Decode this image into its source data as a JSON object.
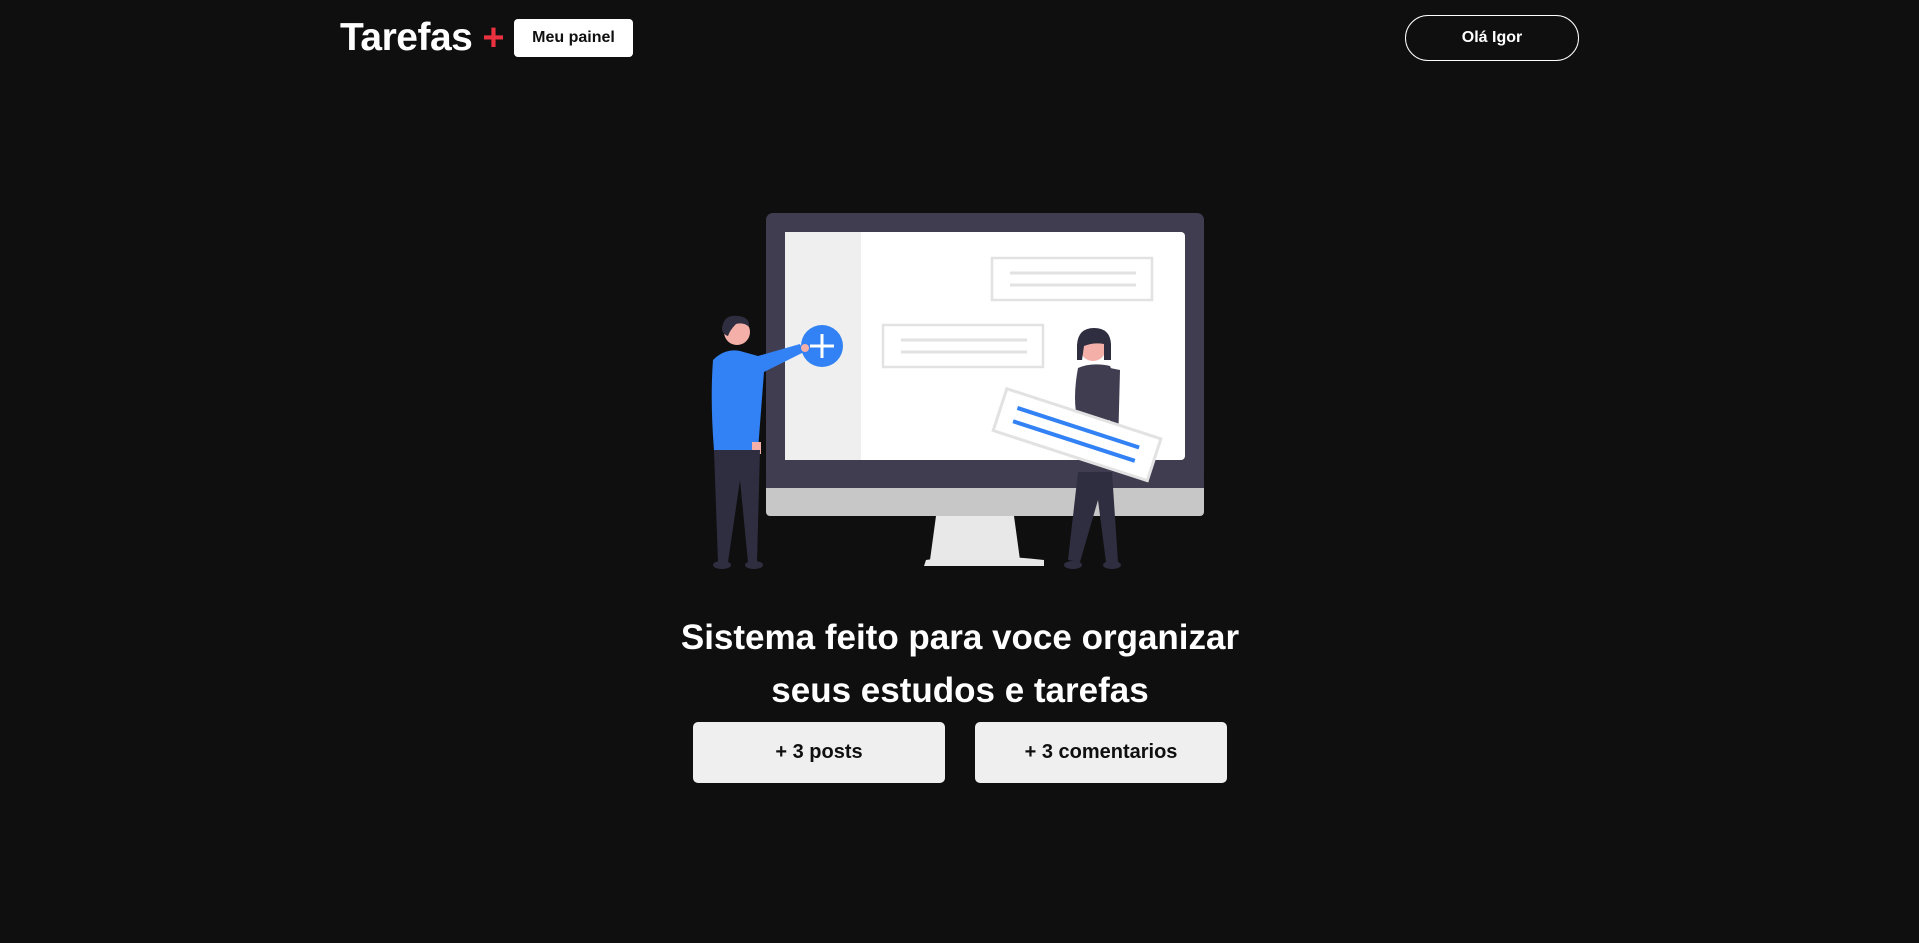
{
  "header": {
    "logo_text": "Tarefas",
    "logo_plus": "+",
    "panel_button": "Meu painel",
    "user_button": "Olá Igor"
  },
  "hero": {
    "illustration": "person-adding-tasks-on-monitor-illustration",
    "title_line1": "Sistema feito para voce organizar",
    "title_line2": "seus estudos e tarefas"
  },
  "stats": {
    "posts": "+ 3 posts",
    "comments": "+ 3 comentarios"
  },
  "colors": {
    "background": "#0f0f0f",
    "accent": "#ea3140",
    "illustration_blue": "#3282f5",
    "stat_card": "#efefef"
  }
}
